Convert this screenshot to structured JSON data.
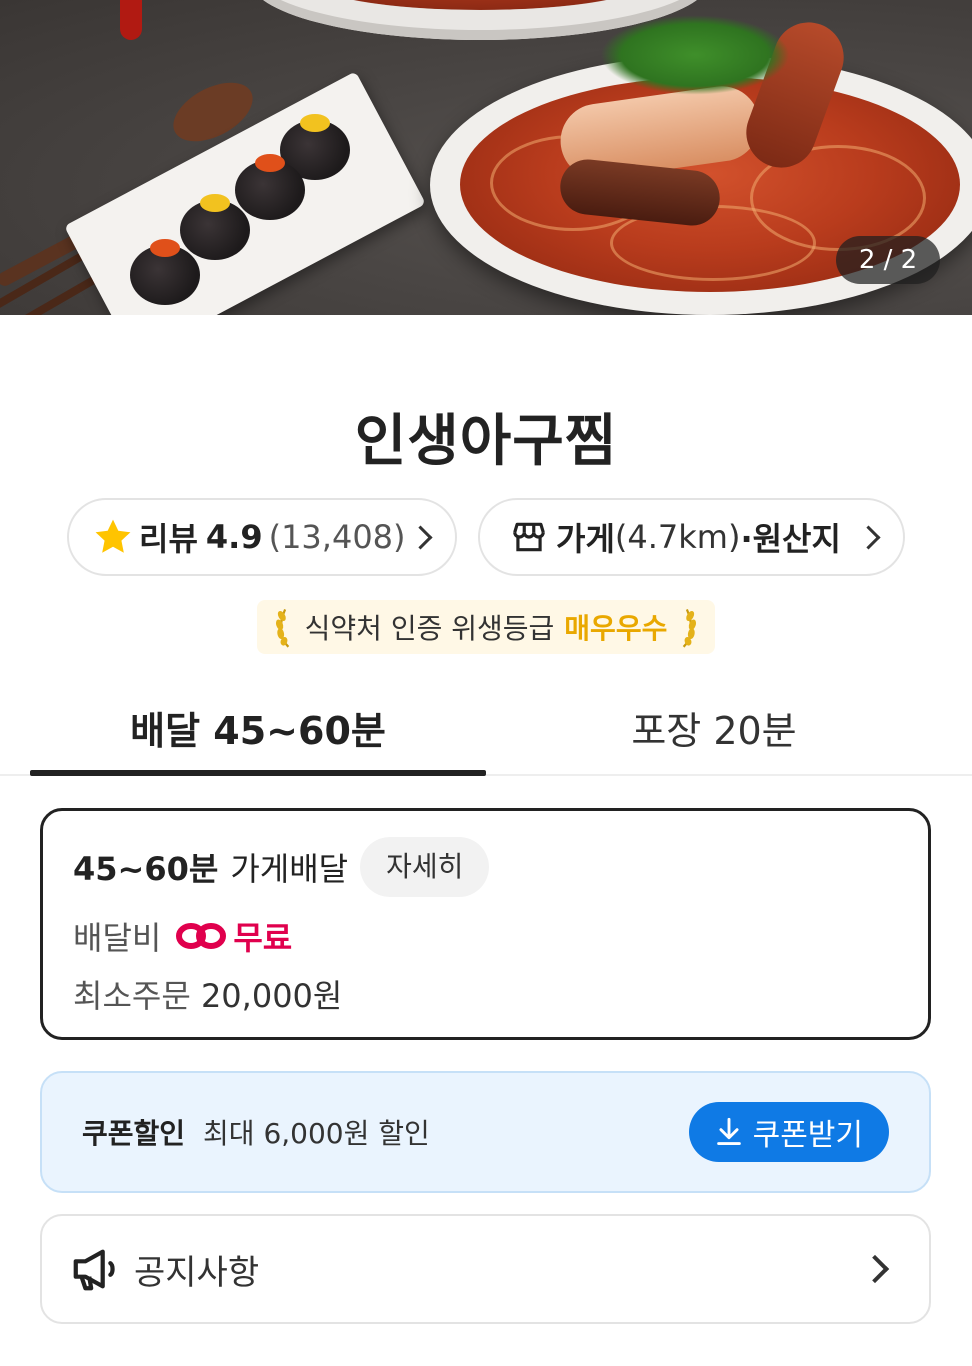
{
  "hero": {
    "page_indicator": "2 / 2"
  },
  "store": {
    "name": "인생아구찜"
  },
  "review_chip": {
    "label": "리뷰",
    "rating": "4.9",
    "count": "(13,408)",
    "icon": "star-icon"
  },
  "store_chip": {
    "label": "가게",
    "distance": "(4.7km)",
    "suffix": "·원산지",
    "icon": "store-icon"
  },
  "hygiene": {
    "text": "식약처 인증 위생등급",
    "grade": "매우우수"
  },
  "tabs": [
    {
      "label": "배달 45~60분",
      "selected": true
    },
    {
      "label": "포장 20분",
      "selected": false
    }
  ],
  "delivery_info": {
    "time": "45~60분",
    "type": "가게배달",
    "detail_label": "자세히",
    "fee_label": "배달비",
    "fee_value": "무료",
    "min_order_label": "최소주문",
    "min_order_value": "20,000원"
  },
  "coupon": {
    "title": "쿠폰할인",
    "desc": "최대 6,000원 할인",
    "button_label": "쿠폰받기"
  },
  "notice": {
    "label": "공지사항",
    "icon": "megaphone-icon"
  },
  "colors": {
    "accent_blue": "#0f7ae5",
    "free_red": "#e0004d",
    "grade_gold": "#e9a800",
    "star_yellow": "#ffc400"
  }
}
